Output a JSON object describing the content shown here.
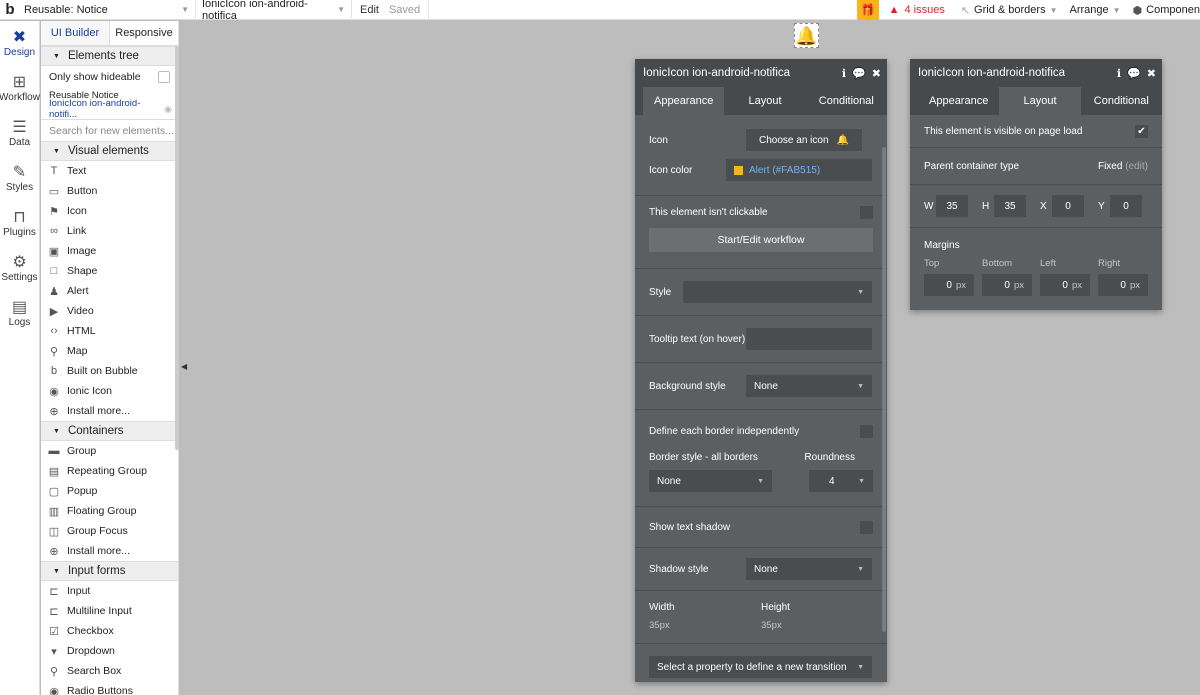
{
  "topbar": {
    "page_select": "Reusable: Notice",
    "element_select": "IonicIcon ion-android-notifica",
    "edit_label": "Edit",
    "saved_label": "Saved",
    "issues": "4 issues",
    "grid": "Grid & borders",
    "arrange": "Arrange",
    "components": "Componen"
  },
  "rail": [
    {
      "label": "Design",
      "icon": "✖"
    },
    {
      "label": "Workflow",
      "icon": "⊞"
    },
    {
      "label": "Data",
      "icon": "☰"
    },
    {
      "label": "Styles",
      "icon": "✎"
    },
    {
      "label": "Plugins",
      "icon": "⊓"
    },
    {
      "label": "Settings",
      "icon": "⚙"
    },
    {
      "label": "Logs",
      "icon": "▤"
    }
  ],
  "palette": {
    "tab_builder": "UI Builder",
    "tab_responsive": "Responsive",
    "elements_tree": "Elements tree",
    "only_hideable": "Only show hideable",
    "tree_root": "Reusable Notice",
    "tree_selected": "IonicIcon ion-android-notifi...",
    "search_placeholder": "Search for new elements...",
    "visual_header": "Visual elements",
    "visual": [
      {
        "icon": "T",
        "label": "Text"
      },
      {
        "icon": "▭",
        "label": "Button"
      },
      {
        "icon": "⚑",
        "label": "Icon"
      },
      {
        "icon": "∞",
        "label": "Link"
      },
      {
        "icon": "▣",
        "label": "Image"
      },
      {
        "icon": "□",
        "label": "Shape"
      },
      {
        "icon": "♟",
        "label": "Alert"
      },
      {
        "icon": "▶",
        "label": "Video"
      },
      {
        "icon": "‹›",
        "label": "HTML"
      },
      {
        "icon": "⚲",
        "label": "Map"
      },
      {
        "icon": "b",
        "label": "Built on Bubble"
      },
      {
        "icon": "◉",
        "label": "Ionic Icon"
      },
      {
        "icon": "⊕",
        "label": "Install more..."
      }
    ],
    "containers_header": "Containers",
    "containers": [
      {
        "icon": "▬",
        "label": "Group"
      },
      {
        "icon": "▤",
        "label": "Repeating Group"
      },
      {
        "icon": "▢",
        "label": "Popup"
      },
      {
        "icon": "▥",
        "label": "Floating Group"
      },
      {
        "icon": "◫",
        "label": "Group Focus"
      },
      {
        "icon": "⊕",
        "label": "Install more..."
      }
    ],
    "inputs_header": "Input forms",
    "inputs": [
      {
        "icon": "⊏",
        "label": "Input"
      },
      {
        "icon": "⊏",
        "label": "Multiline Input"
      },
      {
        "icon": "☑",
        "label": "Checkbox"
      },
      {
        "icon": "▾",
        "label": "Dropdown"
      },
      {
        "icon": "⚲",
        "label": "Search Box"
      },
      {
        "icon": "◉",
        "label": "Radio Buttons"
      }
    ]
  },
  "appearance_panel": {
    "title": "IonicIcon ion-android-notifica",
    "tabs": [
      "Appearance",
      "Layout",
      "Conditional"
    ],
    "icon_label": "Icon",
    "choose_icon": "Choose an icon",
    "icon_color_label": "Icon color",
    "icon_color_value": "Alert (#FAB515)",
    "alert_color": "#FAB515",
    "not_clickable": "This element isn't clickable",
    "start_workflow": "Start/Edit workflow",
    "style_label": "Style",
    "tooltip_label": "Tooltip text (on hover)",
    "bg_style_label": "Background style",
    "bg_style_value": "None",
    "border_independent": "Define each border independently",
    "border_style_label": "Border style - all borders",
    "roundness_label": "Roundness",
    "border_value": "None",
    "roundness_value": "4",
    "text_shadow": "Show text shadow",
    "shadow_style_label": "Shadow style",
    "shadow_style_value": "None",
    "width_label": "Width",
    "width_value": "35px",
    "height_label": "Height",
    "height_value": "35px",
    "transition": "Select a property to define a new transition"
  },
  "layout_panel": {
    "title": "IonicIcon ion-android-notifica",
    "tabs": [
      "Appearance",
      "Layout",
      "Conditional"
    ],
    "visible_label": "This element is visible on page load",
    "parent_label": "Parent container type",
    "parent_value": "Fixed",
    "edit_link": "(edit)",
    "w_label": "W",
    "w_value": "35",
    "h_label": "H",
    "h_value": "35",
    "x_label": "X",
    "x_value": "0",
    "y_label": "Y",
    "y_value": "0",
    "margins_label": "Margins",
    "margin_names": [
      "Top",
      "Bottom",
      "Left",
      "Right"
    ],
    "margin_values": [
      "0",
      "0",
      "0",
      "0"
    ],
    "unit": "px"
  }
}
